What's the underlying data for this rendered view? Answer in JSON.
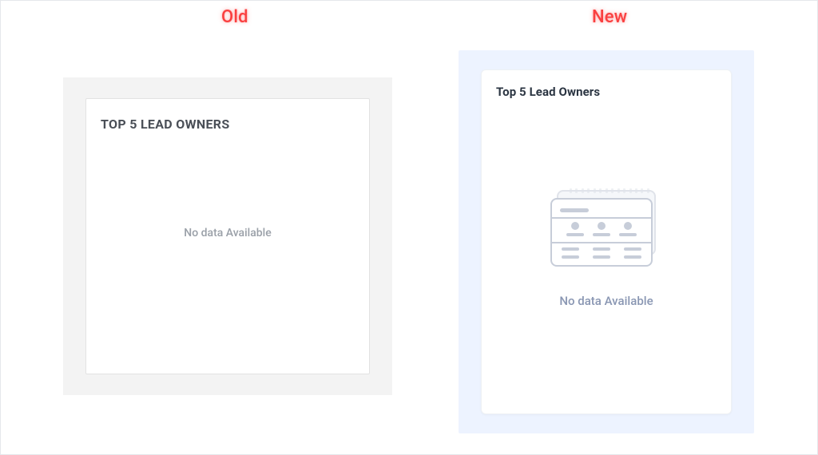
{
  "labels": {
    "old": "Old",
    "new": "New"
  },
  "old": {
    "title": "TOP 5 LEAD OWNERS",
    "empty_text": "No data Available"
  },
  "new": {
    "title": "Top 5 Lead Owners",
    "empty_text": "No data Available"
  }
}
